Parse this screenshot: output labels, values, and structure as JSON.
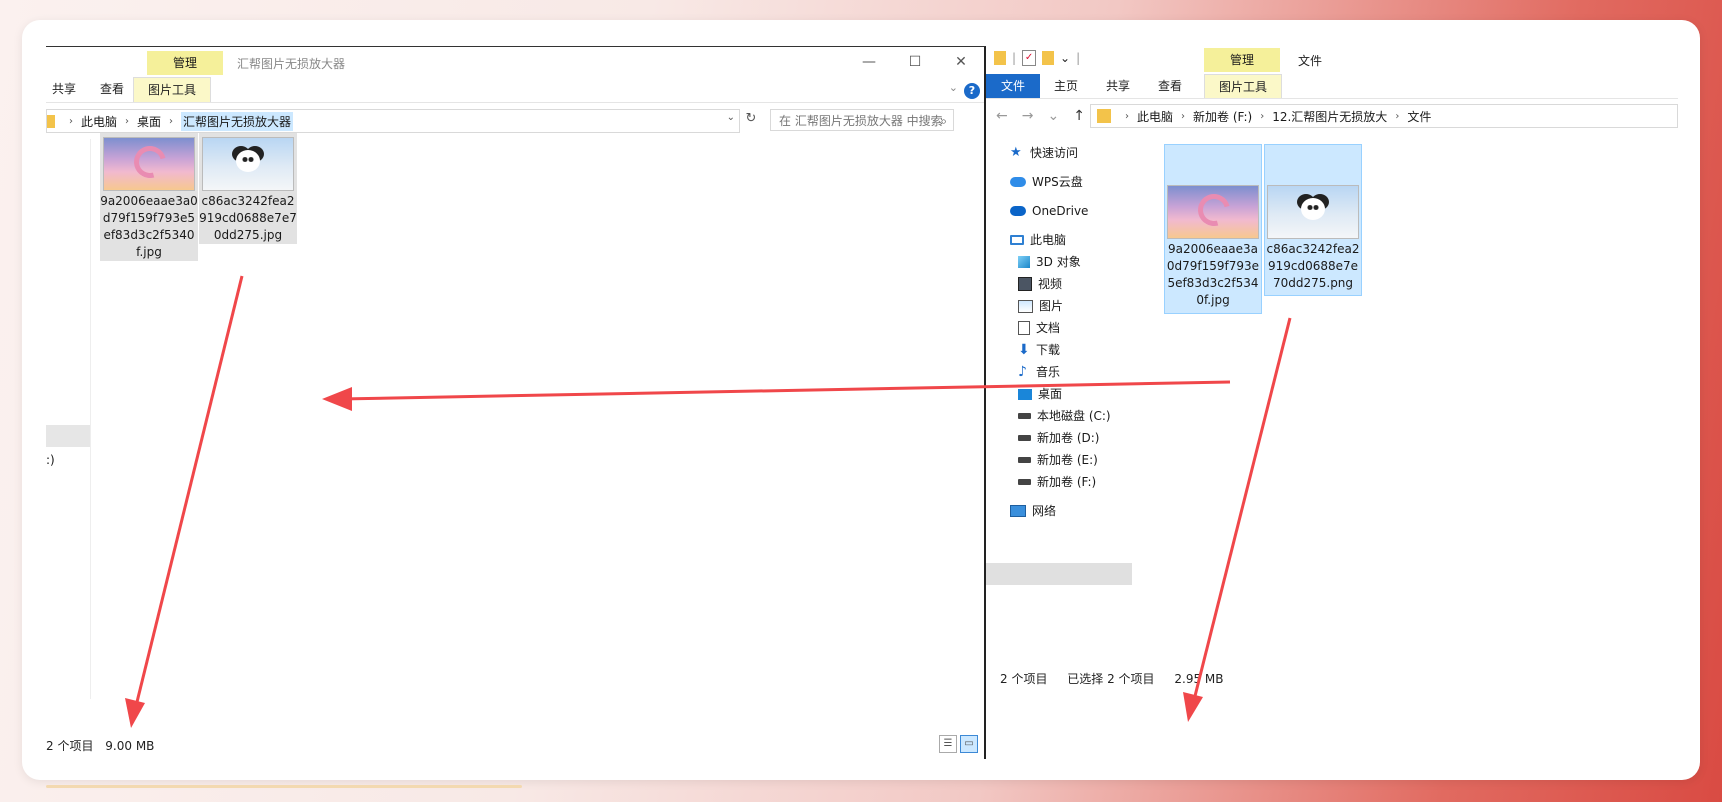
{
  "left_window": {
    "ribbon_context_tab": "管理",
    "title": "汇帮图片无损放大器",
    "controls": {
      "minimize": "—",
      "maximize": "☐",
      "close": "✕"
    },
    "tabs": {
      "share": "共享",
      "view": "查看",
      "picture_tools": "图片工具"
    },
    "help": "?",
    "address": {
      "crumbs": [
        "此电脑",
        "桌面",
        "汇帮图片无损放大器"
      ],
      "sep": "›"
    },
    "search_placeholder": "在 汇帮图片无损放大器 中搜索",
    "nav_partial_label": ":)",
    "files": [
      {
        "name": "9a2006eaae3a0d79f159f793e5ef83d3c2f5340f.jpg",
        "thumb": "dream-moon"
      },
      {
        "name": "c86ac3242fea2919cd0688e7e70dd275.jpg",
        "thumb": "panda"
      }
    ],
    "status": {
      "count": "2 个项目",
      "size": "9.00 MB"
    }
  },
  "right_window": {
    "ribbon_context_tab": "管理",
    "title": "文件",
    "tabs": {
      "file": "文件",
      "home": "主页",
      "share": "共享",
      "view": "查看",
      "picture_tools": "图片工具"
    },
    "address": {
      "crumbs": [
        "此电脑",
        "新加卷 (F:)",
        "12.汇帮图片无损放大",
        "文件"
      ],
      "sep": "›"
    },
    "nav": {
      "quick_access": "快速访问",
      "wps_cloud": "WPS云盘",
      "onedrive": "OneDrive",
      "this_pc": "此电脑",
      "objects_3d": "3D 对象",
      "videos": "视频",
      "pictures": "图片",
      "documents": "文档",
      "downloads": "下载",
      "music": "音乐",
      "desktop": "桌面",
      "drive_c": "本地磁盘 (C:)",
      "drive_d": "新加卷 (D:)",
      "drive_e": "新加卷 (E:)",
      "drive_f": "新加卷 (F:)",
      "network": "网络"
    },
    "files": [
      {
        "name": "9a2006eaae3a0d79f159f793e5ef83d3c2f5340f.jpg",
        "thumb": "dream-moon"
      },
      {
        "name": "c86ac3242fea2919cd0688e7e70dd275.png",
        "thumb": "panda"
      }
    ],
    "status": {
      "count": "2 个项目",
      "selected": "已选择 2 个项目",
      "size": "2.95 MB"
    }
  },
  "annotation_color": "#f0474a"
}
